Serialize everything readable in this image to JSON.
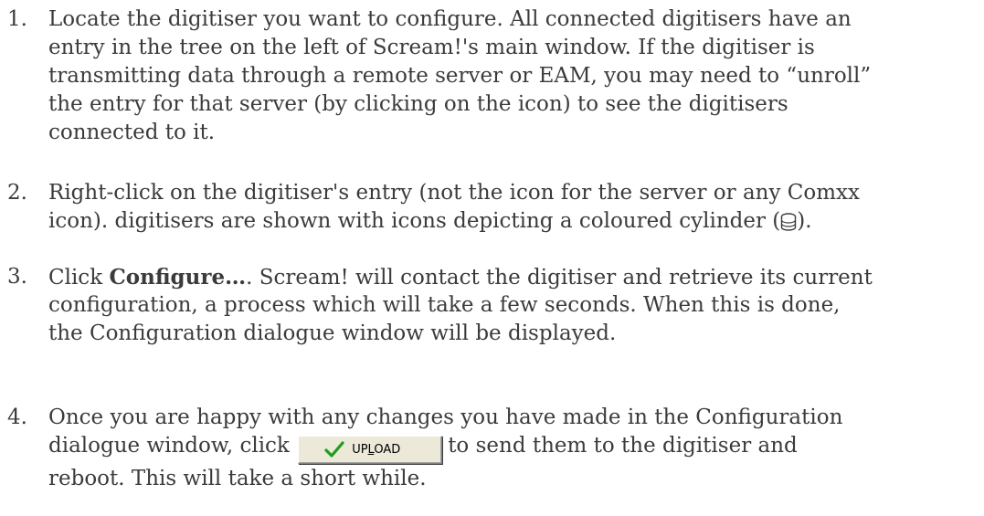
{
  "steps": [
    {
      "number": "1.",
      "lines": [
        "Locate the digitiser you want to configure.  All connected digitisers have an",
        "entry in the tree on the left of Scream!'s main window.  If the digitiser is",
        "transmitting data through a remote server or EAM, you may need to “unroll”",
        "the entry for that server (by clicking on the icon) to see the digitisers",
        "connected to it."
      ]
    },
    {
      "number": "2.",
      "line1": "Right-click on the digitiser's entry (not the icon for the server or any Comxx",
      "line2_before": "icon).  digitisers are shown with icons depicting a coloured cylinder (",
      "line2_after": ")."
    },
    {
      "number": "3.",
      "line1_before": "Click ",
      "line1_bold": "Configure…",
      "line1_after": ". Scream! will contact the digitiser and retrieve its current",
      "line2": "configuration, a process which will take a few seconds.  When this is done,",
      "line3": "the Configuration dialogue window will be displayed."
    },
    {
      "number": "4.",
      "line1": "Once you are happy with any changes you have made in the Configuration",
      "line2_before": "dialogue window, click ",
      "line2_after": "to send them to the digitiser and",
      "line3": "reboot.  This will take a short while."
    }
  ],
  "upload_button": {
    "label_pre": "UP",
    "label_underlined": "L",
    "label_post": "OAD",
    "icon": "checkmark-icon",
    "check_color": "#1f9d1f"
  },
  "cylinder_icon": {
    "name": "cylinder-icon",
    "color": "#3b3b3b"
  }
}
